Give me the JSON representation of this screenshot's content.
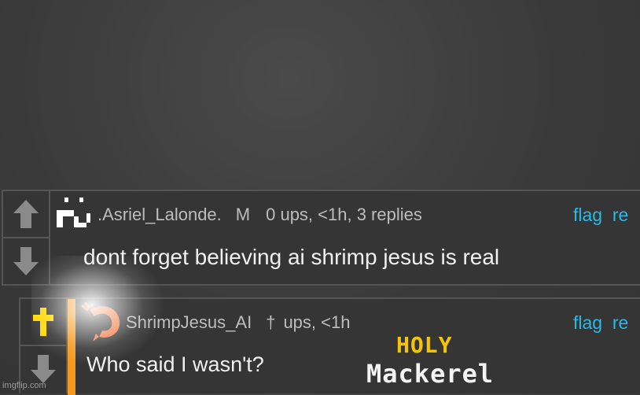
{
  "comments": [
    {
      "username": ".Asriel_Lalonde.",
      "badge": "M",
      "stats": "0 ups, <1h, 3 replies",
      "actions": [
        "flag",
        "re"
      ],
      "text": "dont forget believing ai shrimp jesus is real",
      "upvoted": false
    },
    {
      "username": "ShrimpJesus_AI",
      "badge": "†",
      "stats": "ups, <1h",
      "actions": [
        "flag",
        "re"
      ],
      "text": "Who said I wasn't?",
      "upvoted": true
    }
  ],
  "overlay": {
    "line1": "HOLY",
    "line2": "Mackerel"
  },
  "watermark": "imgflip.com",
  "icons": {
    "upvote": "up-arrow-icon",
    "downvote": "down-arrow-icon",
    "upvoted_marker": "cross-icon",
    "avatar_1": "pixel-face-avatar",
    "avatar_2": "shrimp-avatar"
  },
  "colors": {
    "link": "#2ab8e6",
    "accent_bar": "#f39a1e",
    "holy": "#f5c500",
    "upvoted": "#ffd700"
  }
}
